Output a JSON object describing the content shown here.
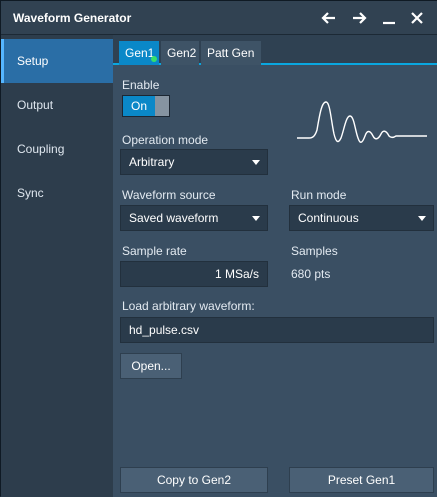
{
  "window": {
    "title": "Waveform Generator"
  },
  "titlebar_buttons": [
    {
      "name": "back-icon"
    },
    {
      "name": "forward-icon"
    },
    {
      "name": "minimize-icon"
    },
    {
      "name": "close-icon"
    }
  ],
  "sidebar": {
    "items": [
      {
        "label": "Setup",
        "active": true
      },
      {
        "label": "Output",
        "active": false
      },
      {
        "label": "Coupling",
        "active": false
      },
      {
        "label": "Sync",
        "active": false
      }
    ]
  },
  "tabs": [
    {
      "label": "Gen1",
      "active": true,
      "indicator": "green-dot"
    },
    {
      "label": "Gen2",
      "active": false
    },
    {
      "label": "Patt Gen",
      "active": false
    }
  ],
  "enable": {
    "label": "Enable",
    "value": "On"
  },
  "operation_mode": {
    "label": "Operation mode",
    "value": "Arbitrary"
  },
  "waveform_source": {
    "label": "Waveform source",
    "value": "Saved waveform"
  },
  "run_mode": {
    "label": "Run mode",
    "value": "Continuous"
  },
  "sample_rate": {
    "label": "Sample rate",
    "value": "1 MSa/s"
  },
  "samples": {
    "label": "Samples",
    "value": "680 pts"
  },
  "load_waveform": {
    "label": "Load arbitrary waveform:",
    "value": "hd_pulse.csv",
    "open_label": "Open..."
  },
  "footer": {
    "copy_label": "Copy to Gen2",
    "preset_label": "Preset Gen1"
  },
  "colors": {
    "accent": "#0a88c8",
    "active_indicator": "#37e06a"
  },
  "preview_icon": "arbitrary-waveform-icon"
}
